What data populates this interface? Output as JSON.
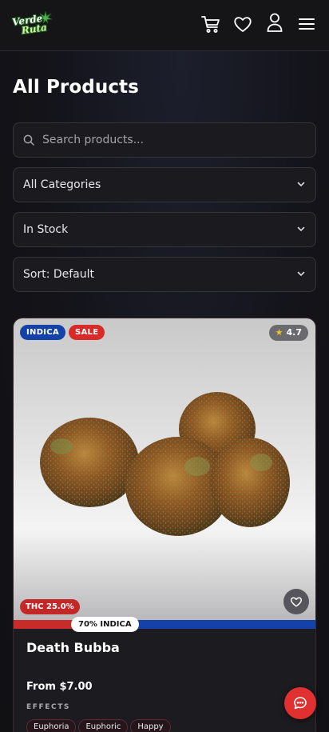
{
  "brand": {
    "logo_line1": "Verde",
    "logo_line2": "Ruta"
  },
  "header": {
    "icons": [
      "cart-icon",
      "heart-icon",
      "user-icon",
      "menu-icon"
    ]
  },
  "page": {
    "title": "All Products"
  },
  "filters": {
    "search_placeholder": "Search products...",
    "category": "All Categories",
    "stock": "In Stock",
    "sort": "Sort: Default"
  },
  "product": {
    "type_badge": "INDICA",
    "sale_badge": "SALE",
    "rating": "4.7",
    "thc": "THC 25.0%",
    "ratio_label": "70% INDICA",
    "indica_fraction": 0.7,
    "name": "Death Bubba",
    "price": "From $7.00",
    "effects_label": "EFFECTS",
    "effects": [
      "Euphoria",
      "Euphoric",
      "Happy"
    ]
  },
  "colors": {
    "indica": "#1442a8",
    "sativa": "#c92a2a",
    "sale": "#d92a2a",
    "accent": "#e0302f",
    "star": "#f2c12e"
  }
}
